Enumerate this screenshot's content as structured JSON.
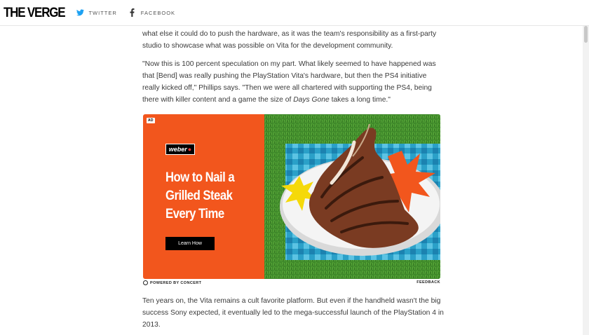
{
  "header": {
    "logo": "THE VERGE",
    "twitter_label": "TWITTER",
    "facebook_label": "FACEBOOK"
  },
  "article": {
    "paragraph_1": "what else it could do to push the hardware, as it was the team's responsibility as a first-party studio to showcase what was possible on Vita for the development community.",
    "paragraph_2_before": "\"Now this is 100 percent speculation on my part. What likely seemed to have happened was that [Bend] was really pushing the PlayStation Vita's hardware, but then the PS4 initiative really kicked off,\" Phillips says. \"Then we were all chartered with supporting the PS4, being there with killer content and a game the size of ",
    "paragraph_2_italic": "Days Gone",
    "paragraph_2_after": " takes a long time.\"",
    "paragraph_3": "Ten years on, the Vita remains a cult favorite platform. But even if the handheld wasn't the big success Sony expected, it eventually led to the mega-successful launch of the PlayStation 4 in 2013."
  },
  "ad": {
    "badge": "AD",
    "brand": "weber",
    "headline": "How to Nail a Grilled Steak Every Time",
    "cta": "Learn How",
    "powered_by": "POWERED BY CONCERT",
    "feedback": "FEEDBACK",
    "colors": {
      "panel": "#f2561d",
      "grass": "#3f8a2a",
      "tablecloth": "#2aa0c8",
      "burst": "#f2561d",
      "star": "#f5d90a"
    }
  }
}
